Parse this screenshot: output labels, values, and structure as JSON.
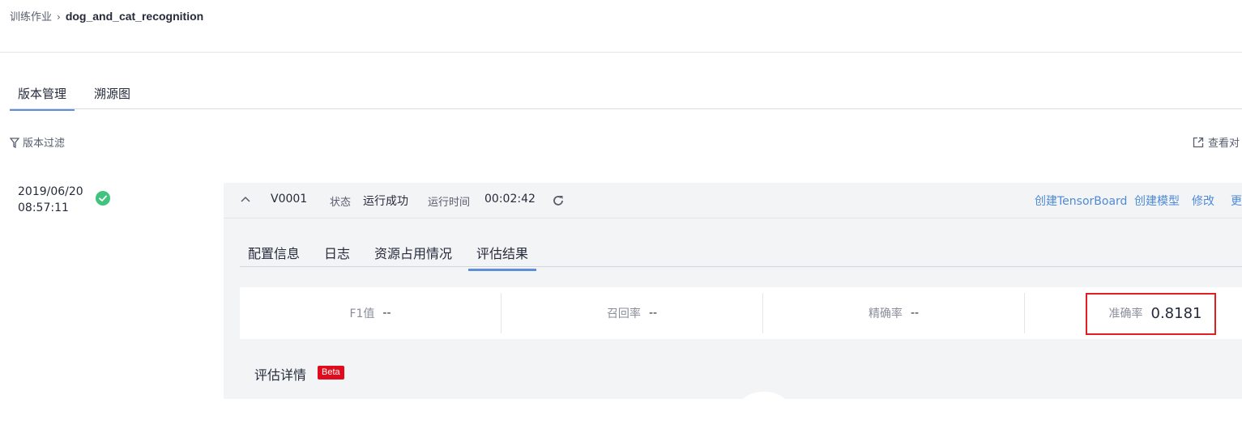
{
  "breadcrumb": {
    "parent": "训练作业",
    "current": "dog_and_cat_recognition"
  },
  "tabs": [
    {
      "label": "版本管理",
      "active": true
    },
    {
      "label": "溯源图",
      "active": false
    }
  ],
  "toolbar": {
    "filter_label": "版本过滤",
    "compare_label": "查看对"
  },
  "version_item": {
    "date": "2019/06/20",
    "time": "08:57:11",
    "status_icon": "check-circle-icon"
  },
  "version_header": {
    "name": "V0001",
    "status_label": "状态",
    "status_value": "运行成功",
    "runtime_label": "运行时间",
    "runtime_value": "00:02:42",
    "actions": [
      "创建TensorBoard",
      "创建模型",
      "修改",
      "更"
    ]
  },
  "subtabs": [
    {
      "label": "配置信息",
      "active": false
    },
    {
      "label": "日志",
      "active": false
    },
    {
      "label": "资源占用情况",
      "active": false
    },
    {
      "label": "评估结果",
      "active": true
    }
  ],
  "metrics": [
    {
      "label": "F1值",
      "value": "--"
    },
    {
      "label": "召回率",
      "value": "--"
    },
    {
      "label": "精确率",
      "value": "--"
    },
    {
      "label": "准确率",
      "value": "0.8181"
    }
  ],
  "evaluation": {
    "title": "评估详情",
    "badge": "Beta"
  },
  "colors": {
    "accent": "#5e8fd8",
    "link": "#4e8ad8",
    "success": "#3fc37f",
    "badge": "#e00b1c",
    "highlight": "#e02020"
  }
}
